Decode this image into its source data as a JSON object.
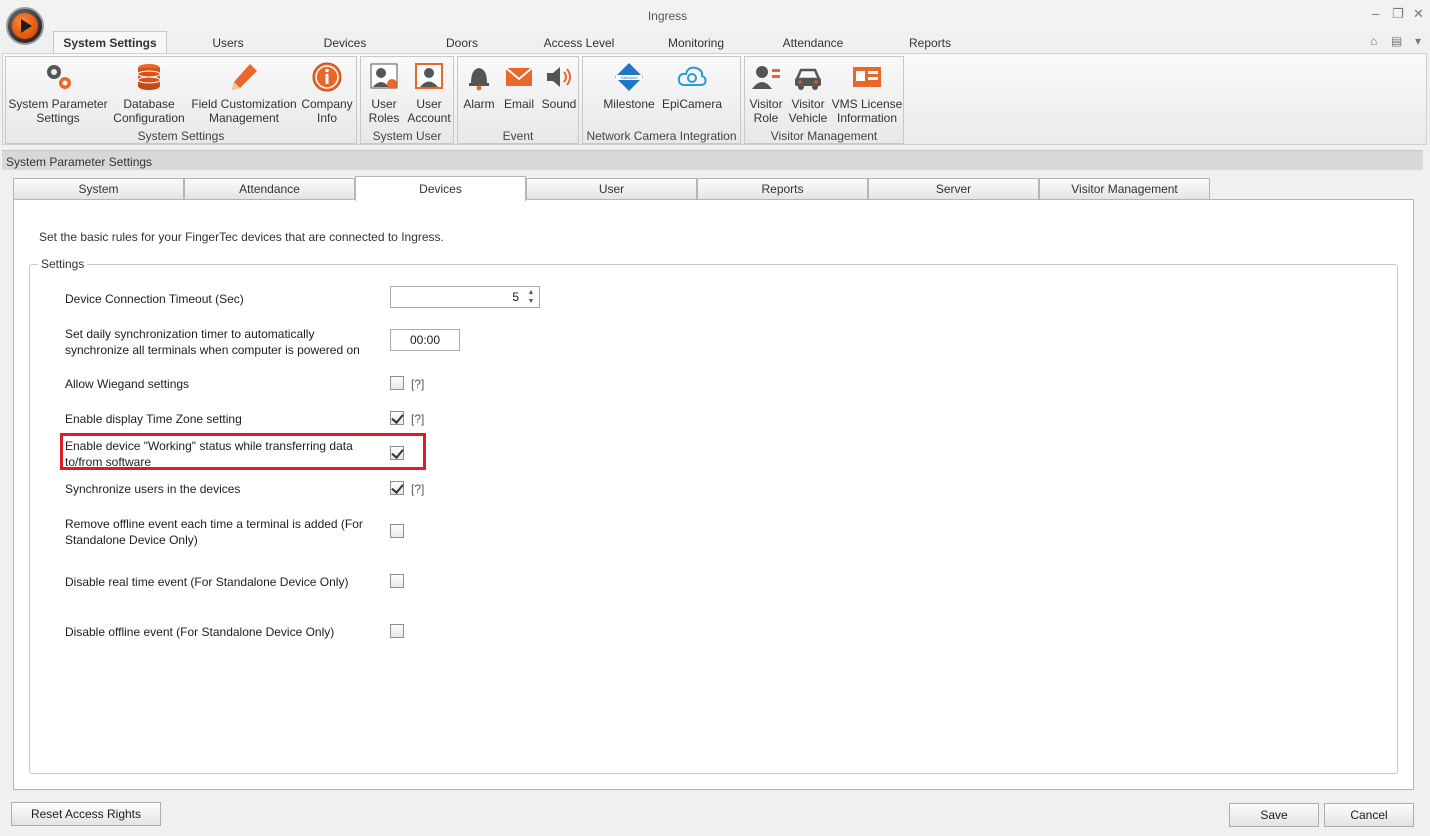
{
  "window": {
    "title": "Ingress",
    "minimize": "–",
    "restore": "❐",
    "close": "✕"
  },
  "quick": {
    "up": "⌂",
    "layout": "▤",
    "menu": "▾"
  },
  "ribbon_tabs": [
    "System Settings",
    "Users",
    "Devices",
    "Doors",
    "Access Level",
    "Monitoring",
    "Attendance",
    "Reports"
  ],
  "ribbon": {
    "system_settings": {
      "label": "System Settings",
      "buttons": [
        "System Parameter\nSettings",
        "Database\nConfiguration",
        "Field Customization\nManagement",
        "Company\nInfo"
      ]
    },
    "system_user": {
      "label": "System User",
      "buttons": [
        "User\nRoles",
        "User\nAccount"
      ]
    },
    "event": {
      "label": "Event",
      "buttons": [
        "Alarm",
        "Email",
        "Sound"
      ]
    },
    "network_camera": {
      "label": "Network Camera Integration",
      "buttons": [
        "Milestone",
        "EpiCamera"
      ],
      "milestone_logo": "milestone"
    },
    "visitor_mgmt": {
      "label": "Visitor Management",
      "buttons": [
        "Visitor\nRole",
        "Visitor\nVehicle",
        "VMS License\nInformation"
      ]
    }
  },
  "panel": {
    "title": "System Parameter Settings"
  },
  "tabs": [
    "System",
    "Attendance",
    "Devices",
    "User",
    "Reports",
    "Server",
    "Visitor Management"
  ],
  "devices": {
    "intro": "Set the basic rules for your FingerTec devices that are connected to Ingress.",
    "group_label": "Settings",
    "timeout": {
      "label": "Device Connection Timeout (Sec)",
      "value": "5"
    },
    "sync_timer": {
      "label": "Set daily synchronization timer to automatically\nsynchronize all terminals when computer is powered on",
      "value": "00:00"
    },
    "wiegand": {
      "label": "Allow Wiegand settings",
      "checked": false,
      "help": "[?]"
    },
    "timezone": {
      "label": "Enable display Time Zone setting",
      "checked": true,
      "help": "[?]"
    },
    "working_status": {
      "label": "Enable device \"Working\" status while transferring data\nto/from software",
      "checked": true
    },
    "sync_users": {
      "label": "Synchronize users in the devices",
      "checked": true,
      "help": "[?]"
    },
    "remove_offline": {
      "label": "Remove offline event each time a terminal is added (For\nStandalone Device Only)",
      "checked": false
    },
    "disable_realtime": {
      "label": "Disable real time event (For Standalone Device Only)",
      "checked": false
    },
    "disable_offline": {
      "label": "Disable offline event (For Standalone Device Only)",
      "checked": false
    }
  },
  "footer": {
    "reset": "Reset Access Rights",
    "save": "Save",
    "cancel": "Cancel"
  },
  "colors": {
    "highlight": "#e01b24",
    "logo_orange": "#e0520b"
  }
}
